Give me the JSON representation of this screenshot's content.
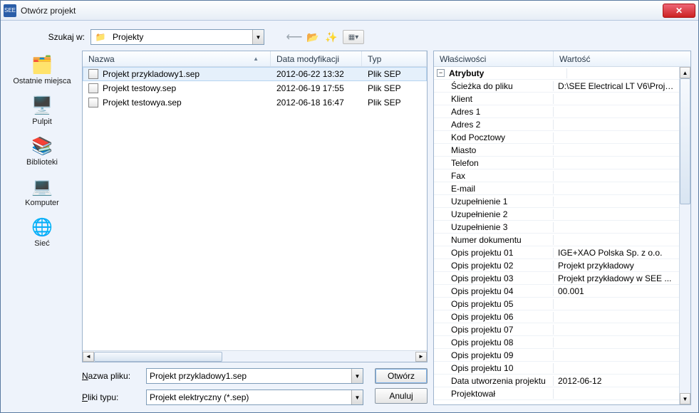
{
  "window": {
    "title": "Otwórz projekt",
    "app_icon_text": "SEE"
  },
  "lookin": {
    "label": "Szukaj w:",
    "value": "Projekty"
  },
  "toolbar_icons": {
    "back": "back-icon",
    "up": "folder-up-icon",
    "new": "new-folder-icon",
    "views": "views-icon"
  },
  "places": [
    {
      "icon": "🗂️",
      "label": "Ostatnie miejsca"
    },
    {
      "icon": "🖥️",
      "label": "Pulpit"
    },
    {
      "icon": "📚",
      "label": "Biblioteki"
    },
    {
      "icon": "💻",
      "label": "Komputer"
    },
    {
      "icon": "🌐",
      "label": "Sieć"
    }
  ],
  "list": {
    "columns": {
      "name": "Nazwa",
      "date": "Data modyfikacji",
      "type": "Typ"
    },
    "rows": [
      {
        "name": "Projekt przykladowy1.sep",
        "date": "2012-06-22 13:32",
        "type": "Plik SEP",
        "selected": true
      },
      {
        "name": "Projekt testowy.sep",
        "date": "2012-06-19 17:55",
        "type": "Plik SEP",
        "selected": false
      },
      {
        "name": "Projekt testowya.sep",
        "date": "2012-06-18 16:47",
        "type": "Plik SEP",
        "selected": false
      }
    ]
  },
  "form": {
    "filename_label": "Nazwa pliku:",
    "filename_value": "Projekt przykladowy1.sep",
    "filetype_label": "Pliki typu:",
    "filetype_value": "Projekt elektryczny (*.sep)"
  },
  "buttons": {
    "open": "Otwórz",
    "cancel": "Anuluj"
  },
  "properties": {
    "head_key": "Właściwości",
    "head_val": "Wartość",
    "group": "Atrybuty",
    "rows": [
      {
        "k": "Ścieżka do pliku",
        "v": "D:\\SEE Electrical LT V6\\Proje..."
      },
      {
        "k": "Klient",
        "v": ""
      },
      {
        "k": "Adres 1",
        "v": ""
      },
      {
        "k": "Adres 2",
        "v": ""
      },
      {
        "k": "Kod Pocztowy",
        "v": ""
      },
      {
        "k": "Miasto",
        "v": ""
      },
      {
        "k": "Telefon",
        "v": ""
      },
      {
        "k": "Fax",
        "v": ""
      },
      {
        "k": "E-mail",
        "v": ""
      },
      {
        "k": "Uzupełnienie 1",
        "v": ""
      },
      {
        "k": "Uzupełnienie 2",
        "v": ""
      },
      {
        "k": "Uzupełnienie 3",
        "v": ""
      },
      {
        "k": "Numer dokumentu",
        "v": ""
      },
      {
        "k": "Opis projektu 01",
        "v": "IGE+XAO Polska Sp. z o.o."
      },
      {
        "k": "Opis projektu 02",
        "v": "Projekt przykładowy"
      },
      {
        "k": "Opis projektu 03",
        "v": "Projekt przykładowy w SEE ..."
      },
      {
        "k": "Opis projektu 04",
        "v": "00.001"
      },
      {
        "k": "Opis projektu 05",
        "v": ""
      },
      {
        "k": "Opis projektu 06",
        "v": ""
      },
      {
        "k": "Opis projektu 07",
        "v": ""
      },
      {
        "k": "Opis projektu 08",
        "v": ""
      },
      {
        "k": "Opis projektu 09",
        "v": ""
      },
      {
        "k": "Opis projektu 10",
        "v": ""
      },
      {
        "k": "Data utworzenia projektu",
        "v": "2012-06-12"
      },
      {
        "k": "Projektował",
        "v": ""
      }
    ]
  }
}
